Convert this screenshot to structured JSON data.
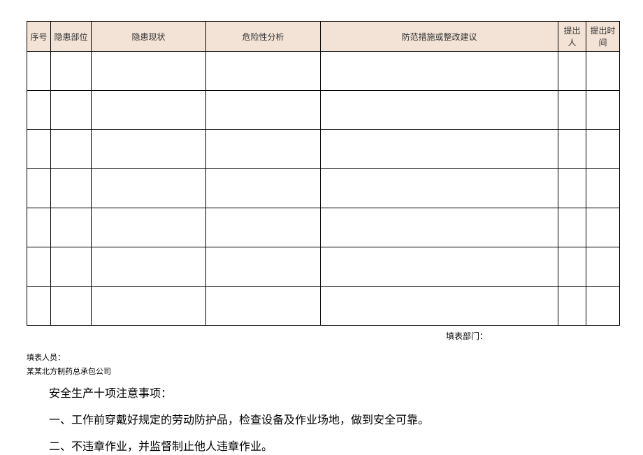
{
  "table": {
    "headers": {
      "seq": "序号",
      "position": "隐患部位",
      "description": "隐患现状",
      "risk": "危险性分析",
      "action": "防范措施或整改建议",
      "proposer": "提出人",
      "time": "提出时间"
    },
    "rowCount": 7
  },
  "footer": {
    "deptLabel": "填表部门：",
    "personLabel": "填表人员：",
    "company": "某某北方制药总承包公司"
  },
  "notes": {
    "title": "安全生产十项注意事项：",
    "items": [
      "一、工作前穿戴好规定的劳动防护品，检查设备及作业场地，做到安全可靠。",
      "二、不违章作业，并监督制止他人违章作业。"
    ]
  }
}
